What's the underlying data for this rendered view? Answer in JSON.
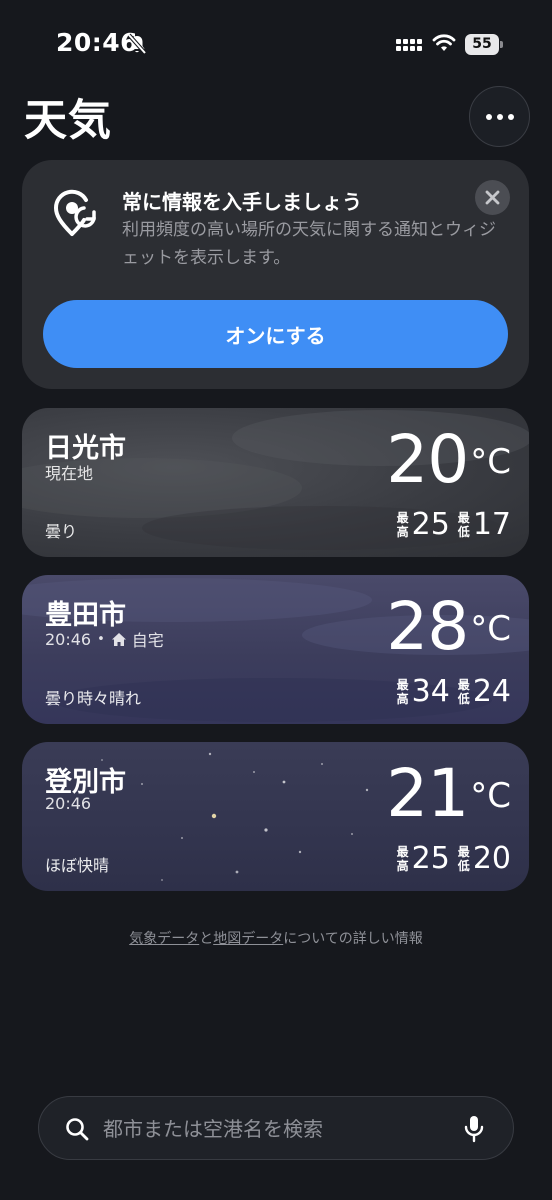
{
  "status_bar": {
    "time": "20:46",
    "battery": "55"
  },
  "header": {
    "title": "天気"
  },
  "notice": {
    "title": "常に情報を入手しましょう",
    "body": "利用頻度の高い場所の天気に関する通知とウィジェットを表示します。",
    "button_label": "オンにする"
  },
  "cities": [
    {
      "name": "日光市",
      "subtitle": "現在地",
      "temperature": "20",
      "unit": "°C",
      "condition": "曇り",
      "high_label": "最高",
      "high": "25",
      "low_label": "最低",
      "low": "17"
    },
    {
      "name": "豊田市",
      "time": "20:46",
      "separator": "•",
      "place": "自宅",
      "temperature": "28",
      "unit": "°C",
      "condition": "曇り時々晴れ",
      "high_label": "最高",
      "high": "34",
      "low_label": "最低",
      "low": "24"
    },
    {
      "name": "登別市",
      "time": "20:46",
      "temperature": "21",
      "unit": "°C",
      "condition": "ほぼ快晴",
      "high_label": "最高",
      "high": "25",
      "low_label": "最低",
      "low": "20"
    }
  ],
  "attribution": {
    "weather_link": "気象データ",
    "and": "と",
    "map_link": "地図データ",
    "suffix": "についての詳しい情報"
  },
  "search": {
    "placeholder": "都市または空港名を検索"
  },
  "colors": {
    "background": "#16181d",
    "accent": "#3f8ef5",
    "card": "#2c2e33"
  }
}
